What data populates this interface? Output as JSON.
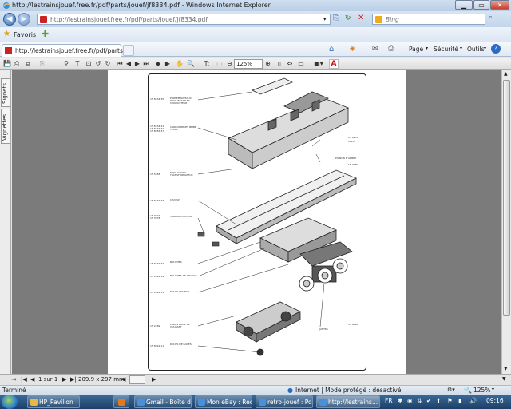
{
  "window": {
    "title": "http://lestrainsjouef.free.fr/pdf/parts/jouef/jf8334.pdf - Windows Internet Explorer"
  },
  "address_bar": {
    "url": "http://lestrainsjouef.free.fr/pdf/parts/jouef/jf8334.pdf"
  },
  "search": {
    "placeholder": "Bing"
  },
  "favorites": {
    "label": "Favoris"
  },
  "tab": {
    "label": "http://lestrainsjouef.free.fr/pdf/parts/j..."
  },
  "command_bar": {
    "page": "Page",
    "security": "Sécurité",
    "tools": "Outils"
  },
  "pdf_toolbar": {
    "zoom": "125%"
  },
  "left_panel": {
    "bookmarks_tab": "Signets",
    "thumbnails_tab": "Vignettes"
  },
  "page_nav": {
    "page_indicator": "1 sur 1",
    "page_size": "209.9 x 297 mm"
  },
  "status": {
    "left": "Terminé",
    "zone": "Internet | Mode protégé : désactivé",
    "zoom": "125%"
  },
  "taskbar": {
    "tasks": [
      {
        "label": "HP_Pavillon",
        "color": "#e6b84a"
      },
      {
        "label": "",
        "color": "#e07a20"
      },
      {
        "label": "Gmail - Boîte d...",
        "color": "#4a90d9"
      },
      {
        "label": "Mon eBay : Réc...",
        "color": "#4a90d9"
      },
      {
        "label": "retro-jouef : Po...",
        "color": "#4a90d9"
      },
      {
        "label": "http://lestrains...",
        "color": "#4a90d9"
      }
    ],
    "clock": "09:16"
  },
  "document": {
    "labels_left": [
      {
        "num": "15 8334 35",
        "text": "PORTEMANTEAUX POUR BOCHE ET CONDUCTEUR"
      },
      {
        "num": "15 8334 31\n15 8334 32\n15 8055 37",
        "text": "CARROSSERIES BBBB 12000"
      },
      {
        "num": "15 5858",
        "text": "ENJOLIVEURS TRANSFORMATEUR"
      },
      {
        "num": "15 8334 33",
        "text": "CHASSIS"
      },
      {
        "num": "15 3977\n15 3978",
        "text": "TAMPONS BUFFER"
      },
      {
        "num": "15 8334 34",
        "text": "BOUCHES"
      },
      {
        "num": "15 8091 34",
        "text": "BOUCHES DE CHASSIS"
      },
      {
        "num": "15 8091 11",
        "text": "ROUES MOTEUR"
      },
      {
        "num": "15 2569",
        "text": "LAMES PRISE DE COURANT"
      },
      {
        "num": "15 8091 11",
        "text": "ROUES DE LAMES"
      }
    ],
    "labels_right": [
      {
        "num": "15 9253",
        "text": "CLES"
      },
      {
        "num": "15 3280",
        "text": "PIGNON D'ARBRE"
      },
      {
        "num": "15 8016",
        "text": "JANTES"
      }
    ]
  }
}
